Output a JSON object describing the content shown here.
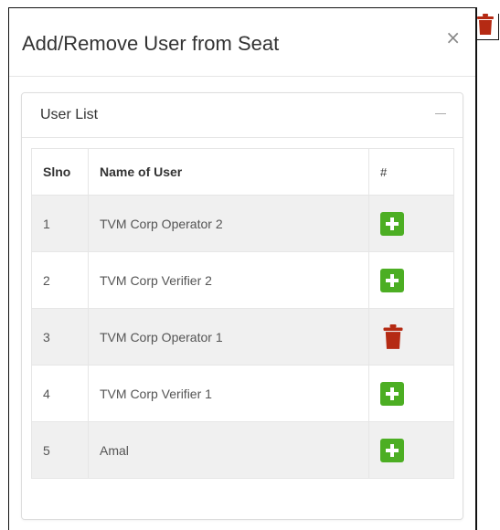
{
  "modal": {
    "title": "Add/Remove User from Seat",
    "close_glyph": "×"
  },
  "panel": {
    "title": "User List"
  },
  "table": {
    "headers": [
      "Slno",
      "Name of User",
      "#"
    ],
    "rows": [
      {
        "slno": "1",
        "name": "TVM Corp Operator 2",
        "action": "add"
      },
      {
        "slno": "2",
        "name": "TVM Corp Verifier 2",
        "action": "add"
      },
      {
        "slno": "3",
        "name": "TVM Corp Operator 1",
        "action": "remove"
      },
      {
        "slno": "4",
        "name": "TVM Corp Verifier 1",
        "action": "add"
      },
      {
        "slno": "5",
        "name": "Amal",
        "action": "add"
      }
    ]
  },
  "icons": {
    "add": "plus-square-icon",
    "remove": "trash-icon",
    "close": "close-icon",
    "collapse": "minus-icon"
  },
  "colors": {
    "add": "#4cae23",
    "remove": "#b52a13",
    "stripe": "#f0f0f0"
  }
}
